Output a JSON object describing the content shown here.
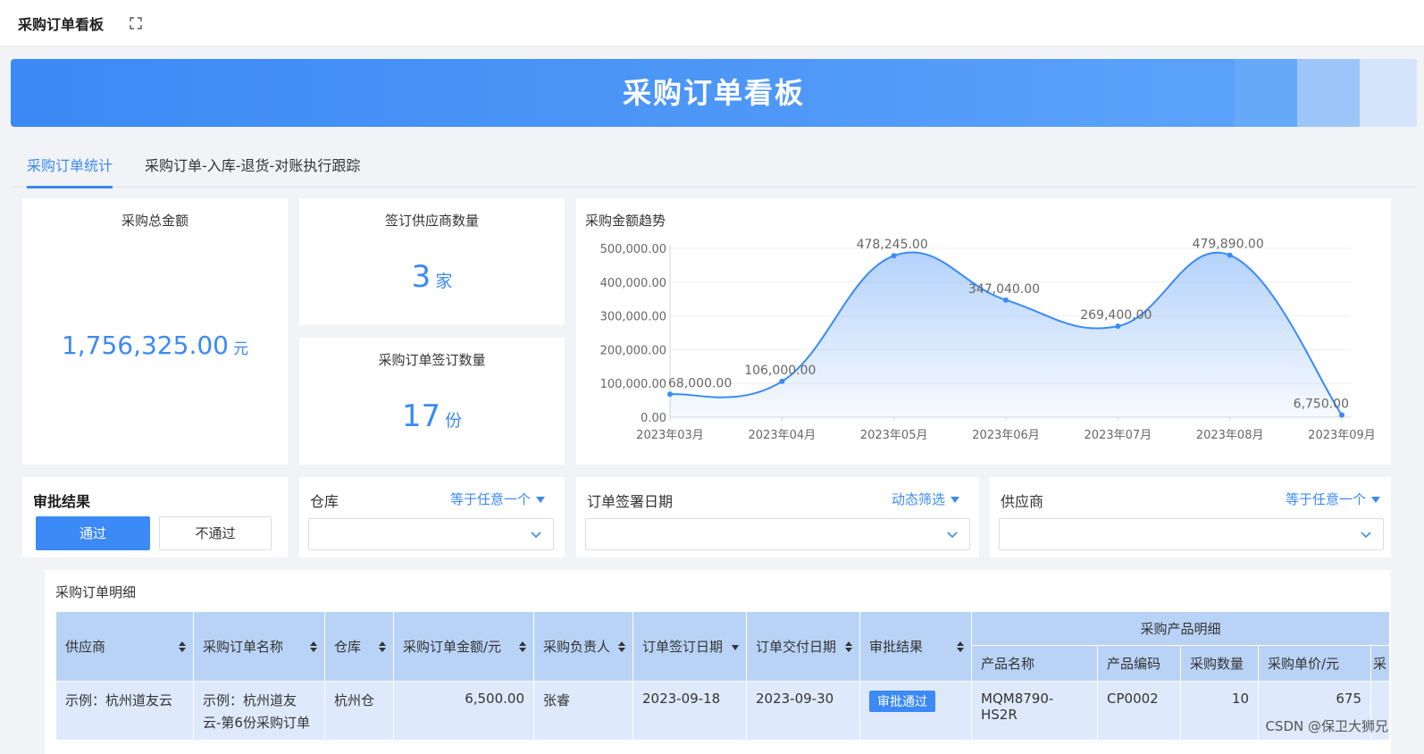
{
  "topbar": {
    "title": "采购订单看板",
    "expand_icon": "expand-icon"
  },
  "banner": {
    "title": "采购订单看板"
  },
  "tabs": [
    {
      "label": "采购订单统计",
      "active": true
    },
    {
      "label": "采购订单-入库-退货-对账执行跟踪",
      "active": false
    }
  ],
  "kpi": {
    "total_amount": {
      "title": "采购总金额",
      "value": "1,756,325.00",
      "unit": "元"
    },
    "supplier_count": {
      "title": "签订供应商数量",
      "value": "3",
      "unit": "家"
    },
    "order_count": {
      "title": "采购订单签订数量",
      "value": "17",
      "unit": "份"
    }
  },
  "chart_title": "采购金额趋势",
  "chart_data": {
    "type": "area",
    "title": "采购金额趋势",
    "categories": [
      "2023年03月",
      "2023年04月",
      "2023年05月",
      "2023年06月",
      "2023年07月",
      "2023年08月",
      "2023年09月"
    ],
    "values": [
      68000,
      106000,
      478245,
      347040,
      269400,
      479890,
      6750
    ],
    "value_labels": [
      "68,000.00",
      "106,000.00",
      "478,245.00",
      "347,040.00",
      "269,400.00",
      "479,890.00",
      "6,750.00"
    ],
    "yticks": [
      "0.00",
      "100,000.00",
      "200,000.00",
      "300,000.00",
      "400,000.00",
      "500,000.00"
    ],
    "ylim": [
      0,
      500000
    ],
    "grid": true,
    "color": "#3b8af5"
  },
  "filters": {
    "approval": {
      "title": "审批结果",
      "options": [
        "通过",
        "不通过"
      ],
      "selected": "通过"
    },
    "warehouse": {
      "title": "仓库",
      "mode": "等于任意一个",
      "value": ""
    },
    "sign_date": {
      "title": "订单签署日期",
      "mode": "动态筛选",
      "value": ""
    },
    "supplier": {
      "title": "供应商",
      "mode": "等于任意一个",
      "value": ""
    }
  },
  "detail": {
    "title": "采购订单明细",
    "group_header": "采购产品明细",
    "columns": [
      "供应商",
      "采购订单名称",
      "仓库",
      "采购订单金额/元",
      "采购负责人",
      "订单签订日期",
      "订单交付日期",
      "审批结果"
    ],
    "sub_columns": [
      "产品名称",
      "产品编码",
      "采购数量",
      "采购单价/元",
      "采"
    ],
    "rows": [
      {
        "supplier": "示例：杭州道友云",
        "order_name_1": "示例：杭州道友",
        "order_name_2": "云-第6份采购订单",
        "warehouse": "杭州仓",
        "amount": "6,500.00",
        "owner": "张睿",
        "sign_date": "2023-09-18",
        "delivery_date": "2023-09-30",
        "approval": "审批通过",
        "product_name": "MQM8790-HS2R",
        "product_code": "CP0002",
        "quantity": "10",
        "unit_price": "675"
      }
    ]
  },
  "watermark": "CSDN @保卫大狮兄"
}
